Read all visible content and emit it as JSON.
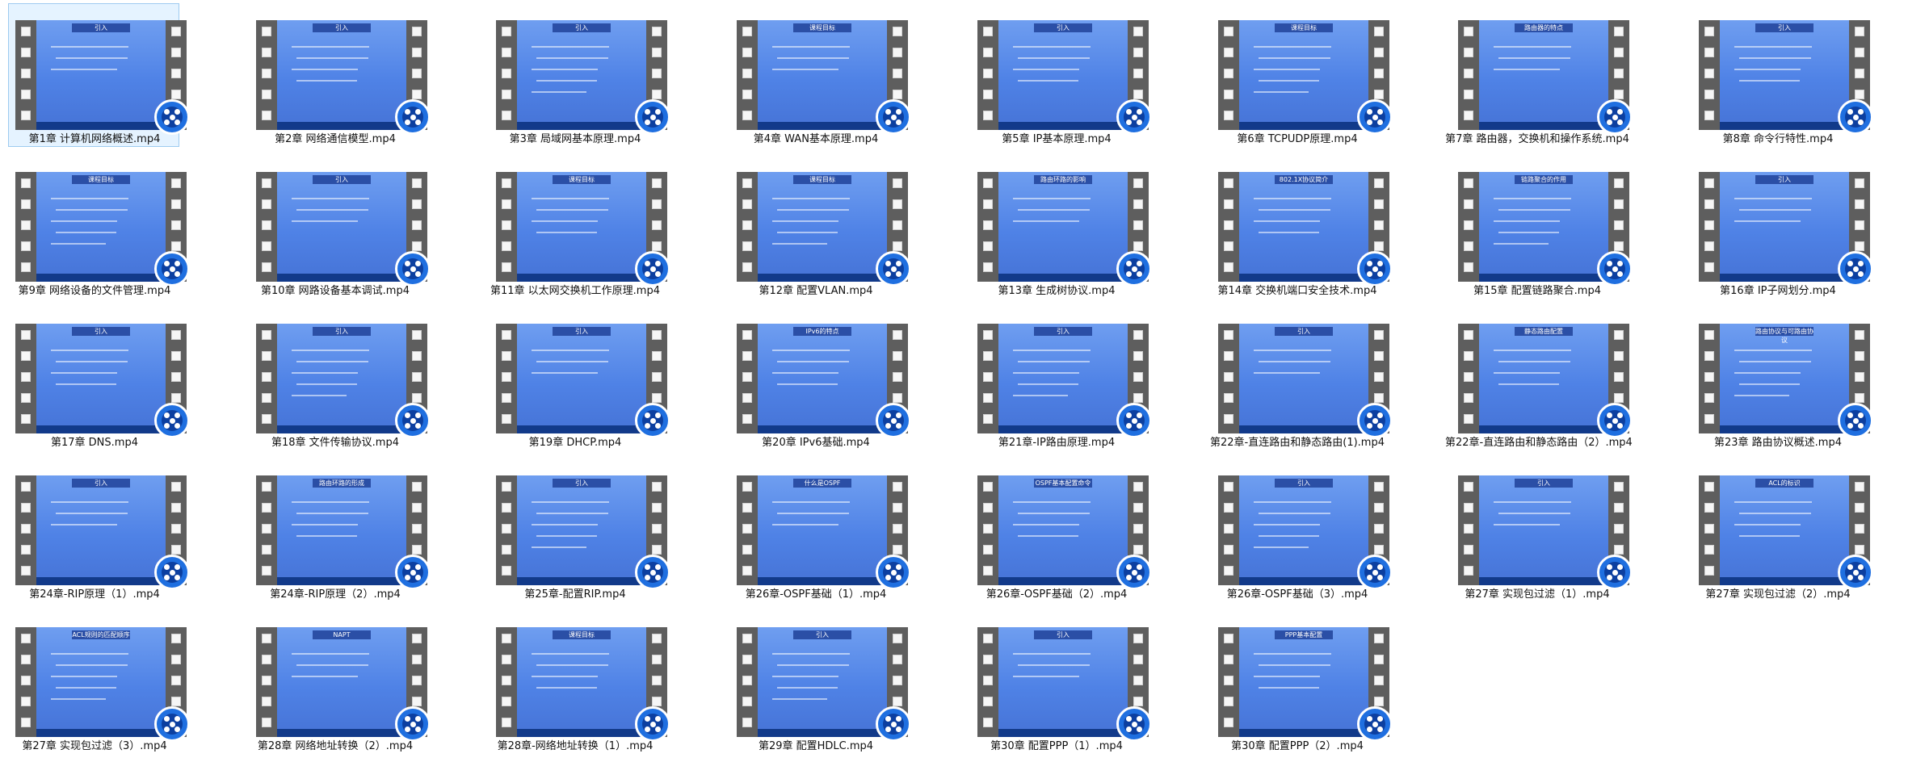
{
  "items": [
    {
      "name": "第1章 计算机网络概述.mp4",
      "slide_title": "引入",
      "selected": true
    },
    {
      "name": "第2章 网络通信模型.mp4",
      "slide_title": "引入"
    },
    {
      "name": "第3章 局域网基本原理.mp4",
      "slide_title": "引入"
    },
    {
      "name": "第4章 WAN基本原理.mp4",
      "slide_title": "课程目标"
    },
    {
      "name": "第5章 IP基本原理.mp4",
      "slide_title": "引入"
    },
    {
      "name": "第6章 TCPUDP原理.mp4",
      "slide_title": "课程目标"
    },
    {
      "name": "第7章 路由器，交换机和操作系统.mp4",
      "slide_title": "路由器的特点"
    },
    {
      "name": "第8章 命令行特性.mp4",
      "slide_title": "引入"
    },
    {
      "name": "第9章 网络设备的文件管理.mp4",
      "slide_title": "课程目标"
    },
    {
      "name": "第10章 网路设备基本调试.mp4",
      "slide_title": "引入"
    },
    {
      "name": "第11章 以太网交换机工作原理.mp4",
      "slide_title": "课程目标"
    },
    {
      "name": "第12章 配置VLAN.mp4",
      "slide_title": "课程目标"
    },
    {
      "name": "第13章 生成树协议.mp4",
      "slide_title": "路由环路的影响"
    },
    {
      "name": "第14章 交换机端口安全技术.mp4",
      "slide_title": "802.1X协议简介"
    },
    {
      "name": "第15章 配置链路聚合.mp4",
      "slide_title": "链路聚合的作用"
    },
    {
      "name": "第16章 IP子网划分.mp4",
      "slide_title": "引入"
    },
    {
      "name": "第17章 DNS.mp4",
      "slide_title": "引入"
    },
    {
      "name": "第18章 文件传输协议.mp4",
      "slide_title": "引入"
    },
    {
      "name": "第19章 DHCP.mp4",
      "slide_title": "引入"
    },
    {
      "name": "第20章 IPv6基础.mp4",
      "slide_title": "IPv6的特点"
    },
    {
      "name": "第21章-IP路由原理.mp4",
      "slide_title": "引入"
    },
    {
      "name": "第22章-直连路由和静态路由(1).mp4",
      "slide_title": "引入"
    },
    {
      "name": "第22章-直连路由和静态路由（2）.mp4",
      "slide_title": "静态路由配置"
    },
    {
      "name": "第23章 路由协议概述.mp4",
      "slide_title": "路由协议与可路由协议"
    },
    {
      "name": "第24章-RIP原理（1）.mp4",
      "slide_title": "引入"
    },
    {
      "name": "第24章-RIP原理（2）.mp4",
      "slide_title": "路由环路的形成"
    },
    {
      "name": "第25章-配置RIP.mp4",
      "slide_title": "引入"
    },
    {
      "name": "第26章-OSPF基础（1）.mp4",
      "slide_title": "什么是OSPF"
    },
    {
      "name": "第26章-OSPF基础（2）.mp4",
      "slide_title": "OSPF基本配置命令"
    },
    {
      "name": "第26章-OSPF基础（3）.mp4",
      "slide_title": "引入"
    },
    {
      "name": "第27章 实现包过滤（1）.mp4",
      "slide_title": "引入"
    },
    {
      "name": "第27章 实现包过滤（2）.mp4",
      "slide_title": "ACL的标识"
    },
    {
      "name": "第27章 实现包过滤（3）.mp4",
      "slide_title": "ACL规则的匹配顺序"
    },
    {
      "name": "第28章 网络地址转换（2）.mp4",
      "slide_title": "NAPT"
    },
    {
      "name": "第28章-网络地址转换（1）.mp4",
      "slide_title": "课程目标"
    },
    {
      "name": "第29章 配置HDLC.mp4",
      "slide_title": "引入"
    },
    {
      "name": "第30章 配置PPP（1）.mp4",
      "slide_title": "引入"
    },
    {
      "name": "第30章 配置PPP（2）.mp4",
      "slide_title": "PPP基本配置"
    }
  ],
  "icons": {
    "badge": "video-player-icon"
  },
  "colors": {
    "slide_bg": "#5a8ae8",
    "selection_bg": "#e5f3ff",
    "selection_border": "#9ecbf0",
    "film": "#5e5e5e",
    "badge": "#1f6fe0"
  }
}
